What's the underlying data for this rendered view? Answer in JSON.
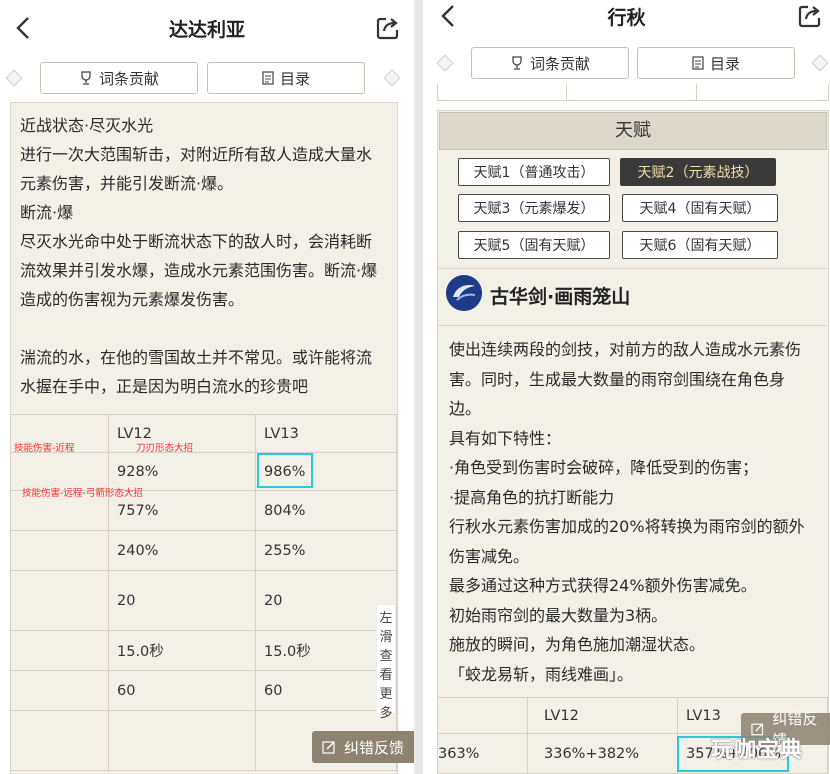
{
  "left": {
    "title": "达达利亚",
    "contrib_label": "词条贡献",
    "toc_label": "目录",
    "paragraphs": [
      "近战状态·尽灭水光",
      "进行一次大范围斩击，对附近所有敌人造成大量水元素伤害，并能引发断流·爆。",
      "断流·爆",
      "尽灭水光命中处于断流状态下的敌人时，会消耗断流效果并引发水爆，造成水元素范围伤害。断流·爆造成的伤害视为元素爆发伤害。",
      "",
      "湍流的水，在他的雪国故土并不常见。或许能将流水握在手中，正是因为明白流水的珍贵吧"
    ],
    "table": {
      "headers": [
        "",
        "LV12",
        "LV13"
      ],
      "rows": [
        [
          "",
          "928%",
          "986%"
        ],
        [
          "",
          "757%",
          "804%"
        ],
        [
          "",
          "240%",
          "255%"
        ],
        [
          "",
          "20",
          "20"
        ],
        [
          "",
          "15.0秒",
          "15.0秒"
        ],
        [
          "",
          "60",
          "60"
        ],
        [
          "",
          "",
          ""
        ]
      ]
    },
    "annotations": {
      "a1": "技能伤害-近程",
      "a2": "刀刃形态大招",
      "a3": "技能伤害-远程-弓箭形态大招"
    },
    "side_hint": [
      "左",
      "滑",
      "查",
      "看",
      "更",
      "多"
    ],
    "feedback_label": "纠错反馈"
  },
  "right": {
    "title": "行秋",
    "contrib_label": "词条贡献",
    "toc_label": "目录",
    "talent_header": "天赋",
    "talent_tabs": [
      "天赋1（普通攻击）",
      "天赋2（元素战技）",
      "天赋3（元素爆发）",
      "天赋4（固有天赋）",
      "天赋5（固有天赋）",
      "天赋6（固有天赋）"
    ],
    "skill_name": "古华剑·画雨笼山",
    "paragraphs": [
      "使出连续两段的剑技，对前方的敌人造成水元素伤害。同时，生成最大数量的雨帘剑围绕在角色身边。",
      "具有如下特性：",
      "·角色受到伤害时会破碎，降低受到的伤害；",
      "·提高角色的抗打断能力",
      "行秋水元素伤害加成的20%将转换为雨帘剑的额外伤害减免。",
      "最多通过这种方式获得24%额外伤害减免。",
      "初始雨帘剑的最大数量为3柄。",
      "施放的瞬间，为角色施加潮湿状态。",
      "「蛟龙易斩，雨线难画」。"
    ],
    "table": {
      "headers": [
        "",
        "LV12",
        "LV13"
      ],
      "rows": [
        [
          "363%",
          "336%+382%",
          "357%+406%"
        ]
      ]
    },
    "feedback_label": "纠错反馈",
    "watermark": "玩咖宝典"
  },
  "colors": {
    "highlight": "#28c8dd",
    "active_tab": "#3a3a3a",
    "feedback_bg": "#8e8271"
  }
}
